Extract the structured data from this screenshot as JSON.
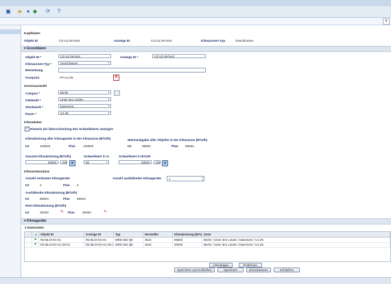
{
  "toolbar": {
    "icons": [
      "home-icon",
      "folder-open-icon",
      "users-icon",
      "refresh-icon",
      "help-icon"
    ]
  },
  "header": {
    "title": "Kopfdaten",
    "objekt_id_label": "Objekt ID",
    "objekt_id_value": "CZ-U1.05-host",
    "anzeige_id_label": "Anzeige ID",
    "anzeige_id_value": "CZ-U1.05-host",
    "zonen_typ_label": "Klimazonen-Typ",
    "zonen_typ_value": "Geschlossen"
  },
  "grunddaten": {
    "title": "Grunddaten",
    "objekt_id_label": "Objekt ID *",
    "objekt_id_value": "CZ-U1.05-host",
    "anzeige_id_label": "Anzeige ID *",
    "anzeige_id_value": "CZ-U1.05-host",
    "typ_label": "Klimazonen-Typ *",
    "typ_value": "Geschlossen",
    "bemerkung_label": "Bemerkung",
    "bemerkung_value": "",
    "footprint_label": "Footprint",
    "footprint_value": "FP-U1.05"
  },
  "zonenauswahl": {
    "title": "Zonenauswahl",
    "campus_label": "Campus *",
    "campus_value": "Berlin",
    "gebaeude_label": "Gebäude *",
    "gebaeude_value": "Unter den Linden",
    "stockwerk_label": "Stockwerk *",
    "stockwerk_value": "basement",
    "raum_label": "Raum *",
    "raum_value": "U1.05"
  },
  "klimadaten": {
    "title": "Klimadaten",
    "hinweis_label": "Hinweis bei Überschreitung des Schwellwerts anzeigen",
    "klimaleistung_title": "Klimaleistung aller Klimageräte in der Klimazone (BTU/h)",
    "ist_label": "Ist",
    "ist_value": "126503",
    "plan_label": "Plan",
    "plan_value": "126503",
    "waerme_title": "Wärmeabgabe aller Objekte in der Klimazone (BTU/h)",
    "waerme_ist_label": "Ist",
    "waerme_ist_value": "58652",
    "waerme_plan_label": "Plan",
    "waerme_plan_value": "58652",
    "gesamt_title": "Gesamt-Klimaleistung (BTU/h)",
    "gesamt_value": "50000",
    "gesamt_dec": "000",
    "schwell_pct_title": "Schwellwert in %",
    "schwell_pct_value": "80",
    "schwell_btu_title": "Schwellwert in BTU/h",
    "schwell_btu_value": "40000",
    "schwell_btu_dec": "000"
  },
  "klimaredundanz": {
    "title": "Klimaredundanz",
    "verbaut_title": "Anzahl verbauter Klimageräte",
    "verbaut_ist_label": "Ist",
    "verbaut_ist_value": "2",
    "verbaut_plan_label": "Plan",
    "verbaut_plan_value": "2",
    "ausfall_title": "Anzahl ausfallender Klimageräte",
    "ausfall_value": "1",
    "ausfall_leistung_title": "Ausfallende Klimaleistung (BTU/h)",
    "ausfall_ist_label": "Ist",
    "ausfall_ist_value": "96503",
    "ausfall_plan_label": "Plan",
    "ausfall_plan_value": "96503",
    "rest_title": "Rest-Klimaleistung (BTU/h)",
    "rest_ist_label": "Ist",
    "rest_ist_value": "30000",
    "rest_plan_label": "Plan",
    "rest_plan_value": "30000"
  },
  "klimageraete": {
    "title": "Klimageräte",
    "count": "2 Datensätze",
    "columns": [
      "Objekt ID",
      "Anzeige ID",
      "Typ",
      "Hersteller",
      "Klimaleistung (BTU",
      "Zone"
    ],
    "rows": [
      [
        "RZ-BLN-KG-01",
        "RZ-BLN-KG-01",
        "MRD 662 QE",
        "Stulz",
        "96503",
        "Berlin / Unter den Linden / basement / U1.05"
      ],
      [
        "RZ-BLN-KG-U1.05-01",
        "RZ-BLN-KG-U1.05-01",
        "MRD 662 QE",
        "Stulz",
        "30000",
        "Berlin / Unter den Linden / basement / U1.05"
      ]
    ],
    "add_button": "Hinzufügen",
    "remove_button": "Entfernen"
  },
  "footer": {
    "save_close": "Speichern und schließen",
    "save": "Speichern",
    "reset": "Zurücksetzen",
    "close": "Schließen"
  }
}
